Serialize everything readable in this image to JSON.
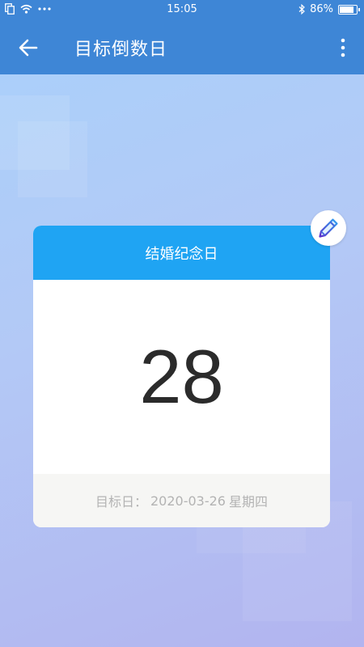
{
  "status_bar": {
    "time": "15:05",
    "battery": "86%",
    "battery_level": 0.86
  },
  "app_bar": {
    "title": "目标倒数日",
    "back_icon": "arrow-left-icon",
    "menu_icon": "more-vertical-icon"
  },
  "card": {
    "name": "结婚纪念日",
    "count": "28",
    "target_label": "目标日：",
    "target_date": "2020-03-26",
    "weekday": "星期四",
    "edit_icon": "pencil-icon"
  },
  "colors": {
    "app_bar": "#3e86d6",
    "card_header": "#1fa4f3",
    "footer": "#f6f6f4"
  }
}
